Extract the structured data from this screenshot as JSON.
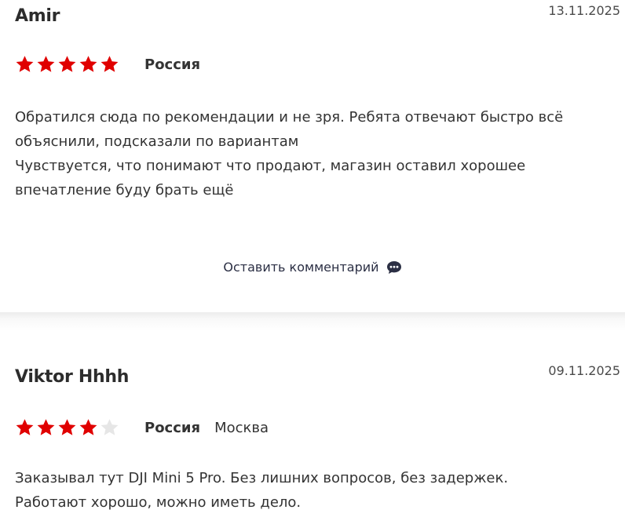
{
  "reviews": [
    {
      "author": "Amir",
      "date": "13.11.2025",
      "rating": 5,
      "country": "Россия",
      "city": "",
      "text_lines": [
        "Обратился сюда по рекомендации и не зря. Ребята отвечают быстро всё объяснили, подсказали по вариантам",
        "Чувствуется, что понимают что продают, магазин оставил хорошее впечатление буду брать ещё"
      ],
      "comment_link_label": "Оставить комментарий"
    },
    {
      "author": "Viktor Hhhh",
      "date": "09.11.2025",
      "rating": 4,
      "country": "Россия",
      "city": "Москва",
      "text_lines": [
        "Заказывал тут DJI Mini 5 Pro. Без лишних вопросов, без задержек. Работают хорошо, можно иметь дело."
      ]
    }
  ],
  "colors": {
    "star_filled": "#e00000",
    "star_empty": "#e6e6e6",
    "comment_icon": "#2b2f44"
  },
  "icons": {
    "star": "star-icon",
    "comment": "speech-bubble-icon"
  }
}
